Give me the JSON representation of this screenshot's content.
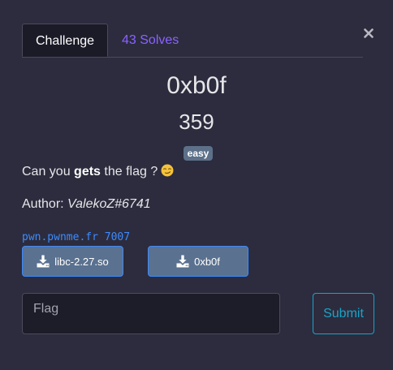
{
  "tabs": {
    "challenge_label": "Challenge",
    "solves_label": "43 Solves"
  },
  "challenge": {
    "name": "0xb0f",
    "points": "359",
    "difficulty": "easy",
    "description": {
      "prefix": "Can you ",
      "bold": "gets",
      "suffix": " the flag ?",
      "emoji": "smirking-face"
    },
    "author": {
      "prefix": "Author: ",
      "name": "ValekoZ#6741"
    },
    "connection": "pwn.pwnme.fr 7007"
  },
  "files": [
    {
      "label": "libc-2.27.so",
      "icon": "download-icon"
    },
    {
      "label": "0xb0f",
      "icon": "download-icon"
    }
  ],
  "submission": {
    "placeholder": "Flag",
    "value": "",
    "submit_label": "Submit"
  },
  "colors": {
    "background": "#2c2c3e",
    "tab_active_bg": "#1b1b28",
    "solves_link": "#8a63ff",
    "badge_bg": "#5c7089",
    "connection_text": "#3d8bfd",
    "file_button_bg": "#5a7190",
    "submit_accent": "#1ba3c6"
  }
}
